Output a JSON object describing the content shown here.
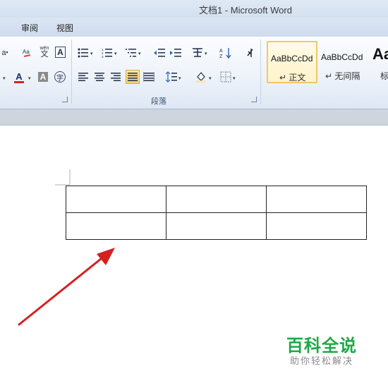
{
  "window": {
    "title": "文档1  -  Microsoft Word"
  },
  "tabs": [
    {
      "label": "审阅"
    },
    {
      "label": "视图"
    }
  ],
  "paragraph_group": {
    "label": "段落"
  },
  "font_group": {
    "size_fragment": "a",
    "pinyin_label": "wén",
    "char_border_label": "A",
    "font_color_label": "A",
    "char_shading_label": "A",
    "enclose_label": "字"
  },
  "styles": [
    {
      "sample": "AaBbCcDd",
      "name": "↵ 正文",
      "active": true
    },
    {
      "sample": "AaBbCcDd",
      "name": "↵ 无间隔",
      "active": false
    },
    {
      "sample": "Aa",
      "name": "标",
      "active": false
    }
  ],
  "document": {
    "table": {
      "rows": 2,
      "cols": 3,
      "cells": [
        [
          "",
          "",
          ""
        ],
        [
          "",
          "",
          ""
        ]
      ]
    }
  },
  "watermark": {
    "title": "百科全说",
    "subtitle": "助你轻松解决"
  },
  "colors": {
    "accent": "#1ea845",
    "arrow": "#d42020",
    "font_color_bar": "#e02020",
    "selected": "#f7cf6d"
  },
  "icons": [
    "bullets-icon",
    "numbering-icon",
    "multilevel-list-icon",
    "decrease-indent-icon",
    "increase-indent-icon",
    "chinese-layout-icon",
    "sort-icon",
    "show-marks-icon",
    "align-left-icon",
    "align-center-icon",
    "align-right-icon",
    "justify-icon",
    "distributed-icon",
    "line-spacing-icon",
    "shading-icon",
    "borders-icon",
    "phonetic-guide-icon",
    "clear-format-icon"
  ]
}
